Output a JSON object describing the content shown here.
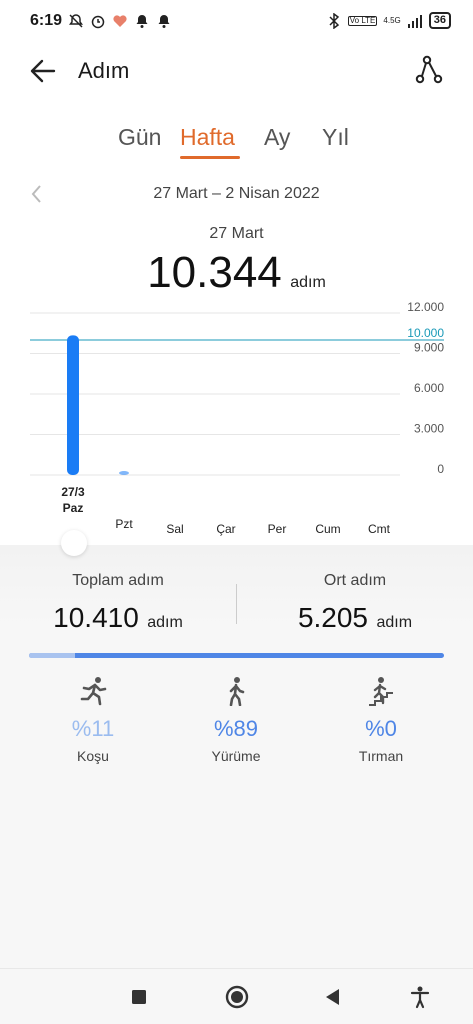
{
  "status_bar": {
    "time": "6:19",
    "net_badge": "Vo LTE",
    "signal_text": "4.5G",
    "battery": "36"
  },
  "header": {
    "title": "Adım",
    "back_icon": "back-arrow-icon",
    "route_icon": "route-icon"
  },
  "tabs": [
    {
      "label": "Gün",
      "active": false
    },
    {
      "label": "Hafta",
      "active": true
    },
    {
      "label": "Ay",
      "active": false
    },
    {
      "label": "Yıl",
      "active": false
    }
  ],
  "date_range": "27 Mart – 2 Nisan 2022",
  "selected": {
    "day": "27 Mart",
    "value": "10.344",
    "unit": "adım"
  },
  "chart_data": {
    "type": "bar",
    "categories": [
      "Paz",
      "Pzt",
      "Sal",
      "Çar",
      "Per",
      "Cum",
      "Cmt"
    ],
    "selected_category_date": "27/3",
    "values": [
      10344,
      66,
      0,
      0,
      0,
      0,
      0
    ],
    "goal": 10000,
    "goal_label": "10.000",
    "y_ticks": [
      0,
      3000,
      6000,
      9000,
      12000
    ],
    "y_tick_labels": [
      "0",
      "3.000",
      "6.000",
      "9.000",
      "12.000"
    ],
    "ylim": [
      0,
      12000
    ],
    "bar_color": "#1a7cf5",
    "goal_color": "#1a9ab8",
    "grid": true
  },
  "summary": {
    "total_label": "Toplam adım",
    "total_value": "10.410",
    "avg_label": "Ort adım",
    "avg_value": "5.205",
    "unit": "adım"
  },
  "progress": {
    "run_fraction": 0.11,
    "light_color": "#a9c3ef",
    "dark_color": "#4f86e6"
  },
  "activities": [
    {
      "icon": "running-icon",
      "percent": "%11",
      "label": "Koşu",
      "color": "#9bbcef"
    },
    {
      "icon": "walking-icon",
      "percent": "%89",
      "label": "Yürüme",
      "color": "#4f86e6"
    },
    {
      "icon": "climbing-icon",
      "percent": "%0",
      "label": "Tırman",
      "color": "#4f86e6"
    }
  ],
  "nav": {
    "recents_icon": "square-icon",
    "home_icon": "home-circle-icon",
    "back_icon": "triangle-back-icon",
    "accessibility_icon": "accessibility-icon"
  },
  "accent_color": "#e06a2b"
}
